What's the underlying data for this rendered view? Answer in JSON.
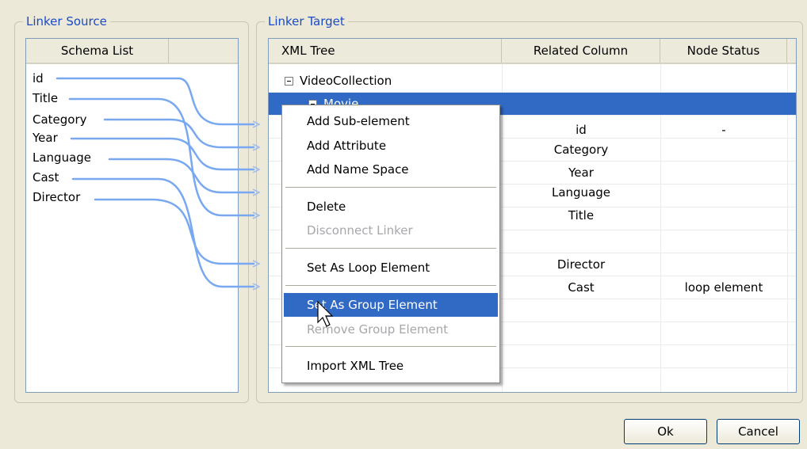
{
  "source": {
    "title": "Linker Source",
    "header": "Schema List",
    "items": [
      "id",
      "Title",
      "Category",
      "Year",
      "Language",
      "Cast",
      "Director"
    ]
  },
  "target": {
    "title": "Linker Target",
    "columns": [
      "XML Tree",
      "Related Column",
      "Node Status"
    ],
    "tree": [
      {
        "label": "VideoCollection",
        "expanded": true
      },
      {
        "label": "Movie",
        "expanded": true,
        "selected": true
      }
    ],
    "rows": [
      {
        "related": "id",
        "status": "-"
      },
      {
        "related": "Category",
        "status": ""
      },
      {
        "related": "Year",
        "status": ""
      },
      {
        "related": "Language",
        "status": ""
      },
      {
        "related": "Title",
        "status": ""
      },
      {
        "related": "",
        "status": ""
      },
      {
        "related": "Director",
        "status": ""
      },
      {
        "related": "Cast",
        "status": "loop element"
      }
    ]
  },
  "context_menu": {
    "items": [
      {
        "label": "Add Sub-element",
        "enabled": true
      },
      {
        "label": "Add Attribute",
        "enabled": true
      },
      {
        "label": "Add Name Space",
        "enabled": true
      },
      {
        "label": "Delete",
        "enabled": true
      },
      {
        "label": "Disconnect Linker",
        "enabled": false
      },
      {
        "label": "Set As Loop Element",
        "enabled": true
      },
      {
        "label": "Set As Group Element",
        "enabled": true,
        "highlighted": true
      },
      {
        "label": "Remove Group Element",
        "enabled": false
      },
      {
        "label": "Import XML Tree",
        "enabled": true
      }
    ]
  },
  "buttons": {
    "ok": "Ok",
    "cancel": "Cancel"
  },
  "colors": {
    "accent": "#1a4ac8",
    "selection": "#316ac5",
    "linker": "#78a8f0"
  }
}
